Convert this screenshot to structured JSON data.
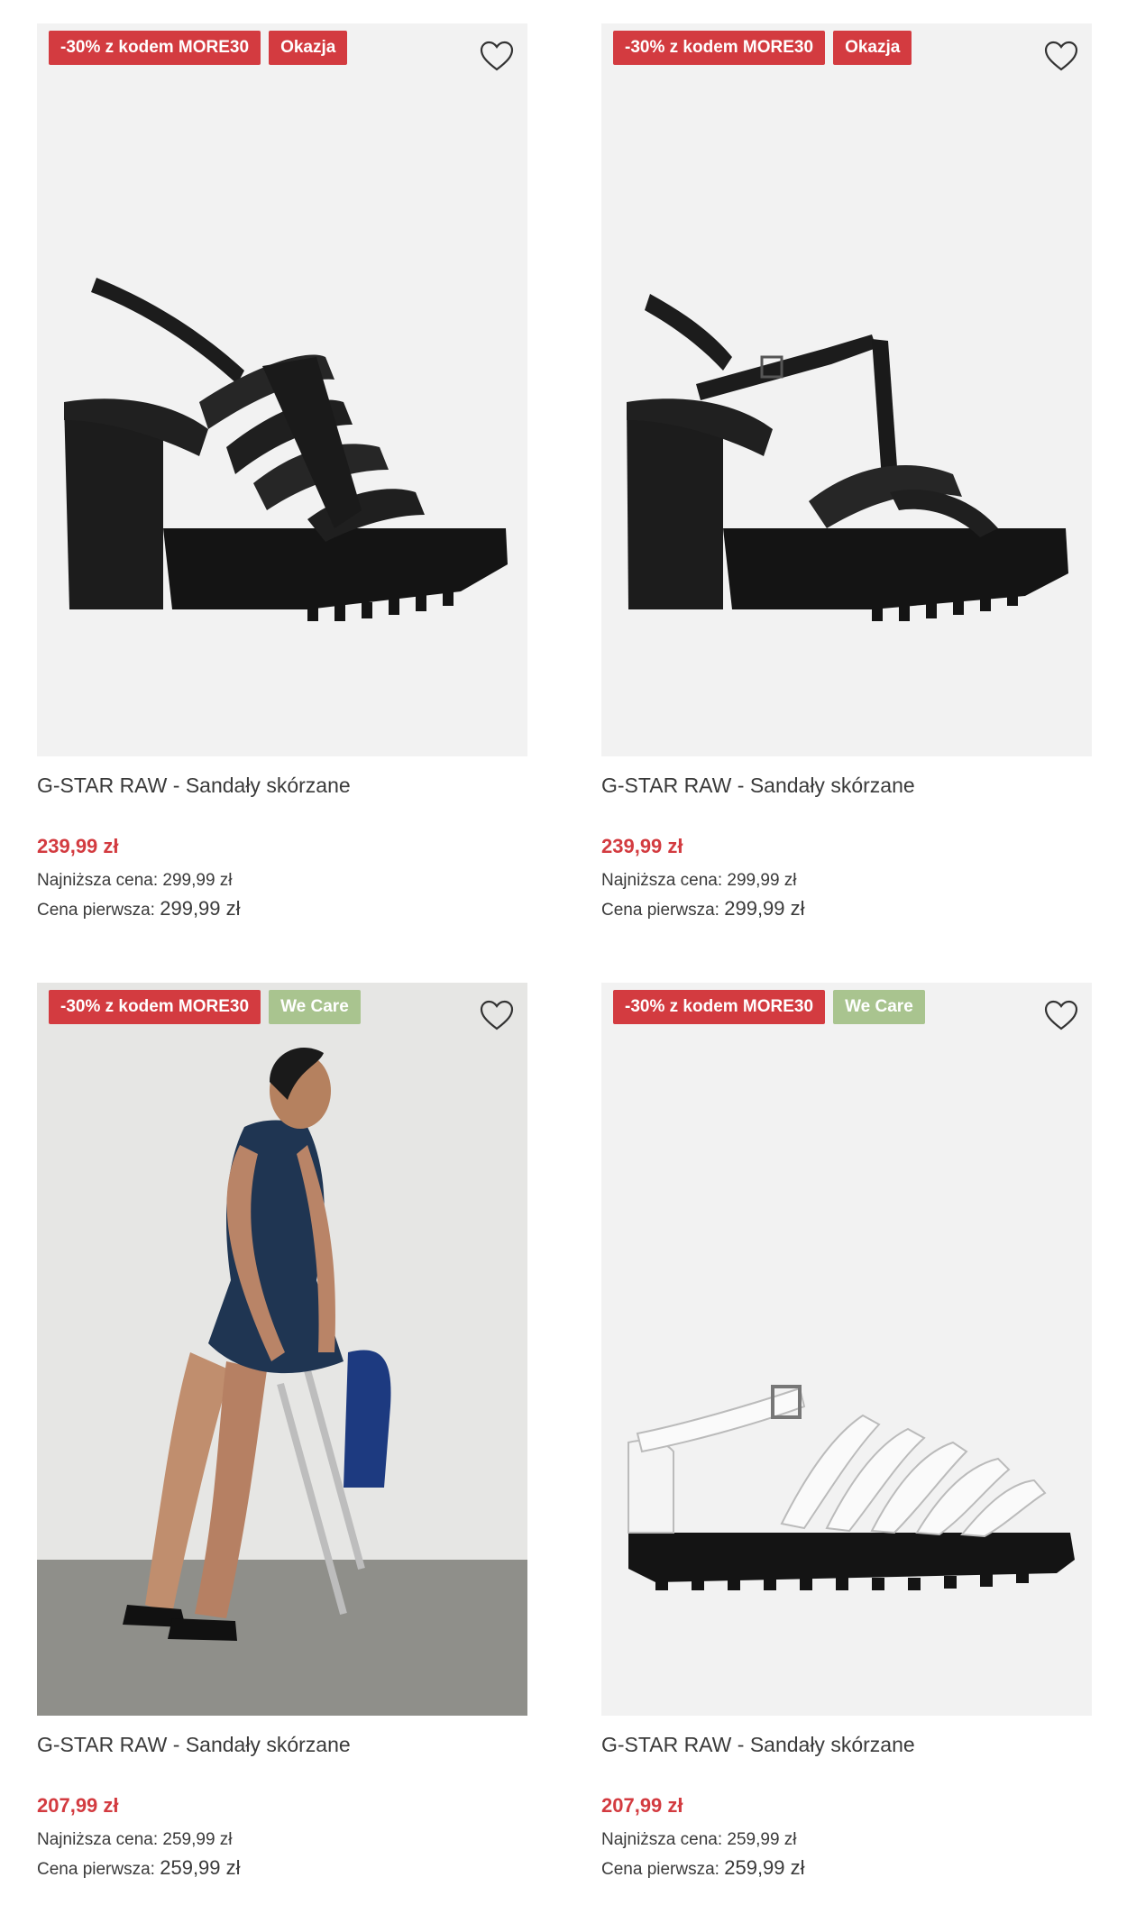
{
  "products": [
    {
      "badges": [
        {
          "label": "-30% z kodem MORE30",
          "color": "#d33b40"
        },
        {
          "label": "Okazja",
          "color": "#d33b40"
        }
      ],
      "name": "G-STAR RAW - Sandały skórzane",
      "price": "239,99 zł",
      "lowest_label": "Najniższa cena:",
      "lowest_value": "299,99 zł",
      "original_label": "Cena pierwsza:",
      "original_value": "299,99 zł",
      "image": "black-caged-platform-heel-sandal"
    },
    {
      "badges": [
        {
          "label": "-30% z kodem MORE30",
          "color": "#d33b40"
        },
        {
          "label": "Okazja",
          "color": "#d33b40"
        }
      ],
      "name": "G-STAR RAW - Sandały skórzane",
      "price": "239,99 zł",
      "lowest_label": "Najniższa cena:",
      "lowest_value": "299,99 zł",
      "original_label": "Cena pierwsza:",
      "original_value": "299,99 zł",
      "image": "black-t-strap-platform-heel-sandal"
    },
    {
      "badges": [
        {
          "label": "-30% z kodem MORE30",
          "color": "#d33b40"
        },
        {
          "label": "We Care",
          "color": "#a9c48f"
        }
      ],
      "name": "G-STAR RAW - Sandały skórzane",
      "price": "207,99 zł",
      "lowest_label": "Najniższa cena:",
      "lowest_value": "259,99 zł",
      "original_label": "Cena pierwsza:",
      "original_value": "259,99 zł",
      "image": "model-wearing-black-fisherman-sandals"
    },
    {
      "badges": [
        {
          "label": "-30% z kodem MORE30",
          "color": "#d33b40"
        },
        {
          "label": "We Care",
          "color": "#a9c48f"
        }
      ],
      "name": "G-STAR RAW - Sandały skórzane",
      "price": "207,99 zł",
      "lowest_label": "Najniższa cena:",
      "lowest_value": "259,99 zł",
      "original_label": "Cena pierwsza:",
      "original_value": "259,99 zł",
      "image": "white-fisherman-sandal"
    }
  ],
  "icons": {
    "favorite": "heart-outline-icon"
  }
}
